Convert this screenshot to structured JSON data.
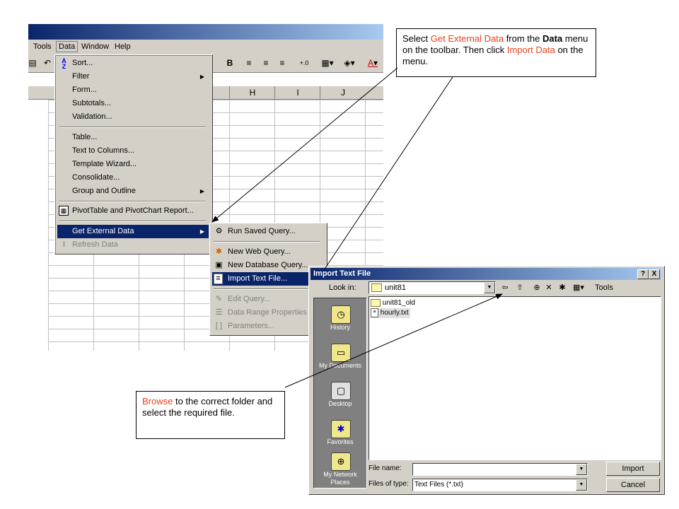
{
  "excel": {
    "menus": [
      "Tools",
      "Data",
      "Window",
      "Help"
    ],
    "toolbar_bold": "B",
    "toolbar_font_color": "A",
    "columns": [
      "H",
      "I",
      "J"
    ]
  },
  "data_menu": {
    "items": [
      {
        "label": "Sort...",
        "icon": "sort-icon"
      },
      {
        "label": "Filter",
        "submenu": true
      },
      {
        "label": "Form..."
      },
      {
        "label": "Subtotals..."
      },
      {
        "label": "Validation..."
      },
      {
        "label": "Table..."
      },
      {
        "label": "Text to Columns..."
      },
      {
        "label": "Template Wizard..."
      },
      {
        "label": "Consolidate..."
      },
      {
        "label": "Group and Outline",
        "submenu": true
      },
      {
        "label": "PivotTable and PivotChart Report...",
        "icon": "pivot-icon"
      },
      {
        "label": "Get External Data",
        "submenu": true,
        "highlighted": true
      },
      {
        "label": "Refresh Data",
        "disabled": true,
        "icon": "refresh-icon"
      }
    ]
  },
  "submenu": {
    "items": [
      {
        "label": "Run Saved Query..."
      },
      {
        "label": "New Web Query..."
      },
      {
        "label": "New Database Query..."
      },
      {
        "label": "Import Text File...",
        "highlighted": true
      },
      {
        "label": "Edit Query...",
        "disabled": true
      },
      {
        "label": "Data Range Properties",
        "disabled": true
      },
      {
        "label": "Parameters...",
        "disabled": true
      }
    ]
  },
  "callout_top": {
    "t1": "Select ",
    "t2": "Get External Data",
    "t3": " from the ",
    "t4": "Data",
    "t5": " menu on the toolbar. Then click ",
    "t6": "Import Data",
    "t7": " on the  menu."
  },
  "callout_bottom": {
    "t1": "Browse",
    "t2": " to the correct folder and select the required file."
  },
  "dialog": {
    "title": "Import Text File",
    "help_btn": "?",
    "close_btn": "X",
    "look_in_label": "Look in:",
    "look_in_value": "unit81",
    "tools_label": "Tools",
    "places": [
      "History",
      "My Documents",
      "Desktop",
      "Favorites",
      "My Network Places"
    ],
    "files": [
      "unit81_old",
      "hourly.txt"
    ],
    "file_name_label": "File name:",
    "file_name_value": "",
    "file_type_label": "Files of type:",
    "file_type_value": "Text Files (*.txt)",
    "import_btn": "Import",
    "cancel_btn": "Cancel"
  }
}
